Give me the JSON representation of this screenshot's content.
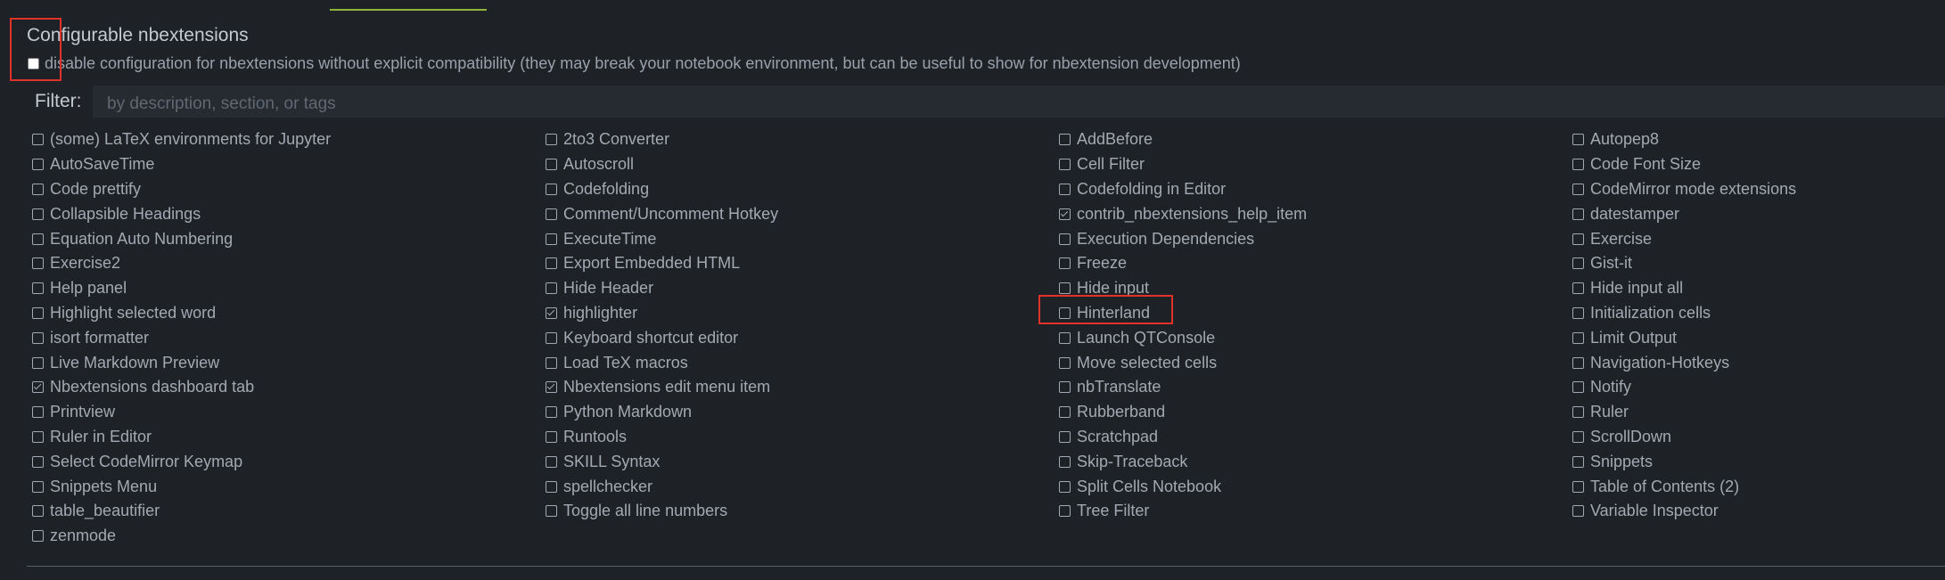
{
  "section": {
    "title": "Configurable nbextensions",
    "compat_label": "disable configuration for nbextensions without explicit compatibility (they may break your notebook environment, but can be useful to show for nbextension development)"
  },
  "filter": {
    "label": "Filter:",
    "placeholder": "by description, section, or tags"
  },
  "extensions": {
    "col1": [
      {
        "label": "(some) LaTeX environments for Jupyter",
        "checked": false
      },
      {
        "label": "AutoSaveTime",
        "checked": false
      },
      {
        "label": "Code prettify",
        "checked": false
      },
      {
        "label": "Collapsible Headings",
        "checked": false
      },
      {
        "label": "Equation Auto Numbering",
        "checked": false
      },
      {
        "label": "Exercise2",
        "checked": false
      },
      {
        "label": "Help panel",
        "checked": false
      },
      {
        "label": "Highlight selected word",
        "checked": false
      },
      {
        "label": "isort formatter",
        "checked": false
      },
      {
        "label": "Live Markdown Preview",
        "checked": false
      },
      {
        "label": "Nbextensions dashboard tab",
        "checked": true
      },
      {
        "label": "Printview",
        "checked": false
      },
      {
        "label": "Ruler in Editor",
        "checked": false
      },
      {
        "label": "Select CodeMirror Keymap",
        "checked": false
      },
      {
        "label": "Snippets Menu",
        "checked": false
      },
      {
        "label": "table_beautifier",
        "checked": false
      },
      {
        "label": "zenmode",
        "checked": false
      }
    ],
    "col2": [
      {
        "label": "2to3 Converter",
        "checked": false
      },
      {
        "label": "Autoscroll",
        "checked": false
      },
      {
        "label": "Codefolding",
        "checked": false
      },
      {
        "label": "Comment/Uncomment Hotkey",
        "checked": false
      },
      {
        "label": "ExecuteTime",
        "checked": false
      },
      {
        "label": "Export Embedded HTML",
        "checked": false
      },
      {
        "label": "Hide Header",
        "checked": false
      },
      {
        "label": "highlighter",
        "checked": true
      },
      {
        "label": "Keyboard shortcut editor",
        "checked": false
      },
      {
        "label": "Load TeX macros",
        "checked": false
      },
      {
        "label": "Nbextensions edit menu item",
        "checked": true
      },
      {
        "label": "Python Markdown",
        "checked": false
      },
      {
        "label": "Runtools",
        "checked": false
      },
      {
        "label": "SKILL Syntax",
        "checked": false
      },
      {
        "label": "spellchecker",
        "checked": false
      },
      {
        "label": "Toggle all line numbers",
        "checked": false
      }
    ],
    "col3": [
      {
        "label": "AddBefore",
        "checked": false
      },
      {
        "label": "Cell Filter",
        "checked": false
      },
      {
        "label": "Codefolding in Editor",
        "checked": false
      },
      {
        "label": "contrib_nbextensions_help_item",
        "checked": true
      },
      {
        "label": "Execution Dependencies",
        "checked": false
      },
      {
        "label": "Freeze",
        "checked": false
      },
      {
        "label": "Hide input",
        "checked": false
      },
      {
        "label": "Hinterland",
        "checked": false
      },
      {
        "label": "Launch QTConsole",
        "checked": false
      },
      {
        "label": "Move selected cells",
        "checked": false
      },
      {
        "label": "nbTranslate",
        "checked": false
      },
      {
        "label": "Rubberband",
        "checked": false
      },
      {
        "label": "Scratchpad",
        "checked": false
      },
      {
        "label": "Skip-Traceback",
        "checked": false
      },
      {
        "label": "Split Cells Notebook",
        "checked": false
      },
      {
        "label": "Tree Filter",
        "checked": false
      }
    ],
    "col4": [
      {
        "label": "Autopep8",
        "checked": false
      },
      {
        "label": "Code Font Size",
        "checked": false
      },
      {
        "label": "CodeMirror mode extensions",
        "checked": false
      },
      {
        "label": "datestamper",
        "checked": false
      },
      {
        "label": "Exercise",
        "checked": false
      },
      {
        "label": "Gist-it",
        "checked": false
      },
      {
        "label": "Hide input all",
        "checked": false
      },
      {
        "label": "Initialization cells",
        "checked": false
      },
      {
        "label": "Limit Output",
        "checked": false
      },
      {
        "label": "Navigation-Hotkeys",
        "checked": false
      },
      {
        "label": "Notify",
        "checked": false
      },
      {
        "label": "Ruler",
        "checked": false
      },
      {
        "label": "ScrollDown",
        "checked": false
      },
      {
        "label": "Snippets",
        "checked": false
      },
      {
        "label": "Table of Contents (2)",
        "checked": false
      },
      {
        "label": "Variable Inspector",
        "checked": false
      }
    ]
  },
  "colors": {
    "background": "#1e2227",
    "text": "#a3a9b2",
    "highlight": "#e0322b",
    "tab_underline": "#8fb33b"
  }
}
